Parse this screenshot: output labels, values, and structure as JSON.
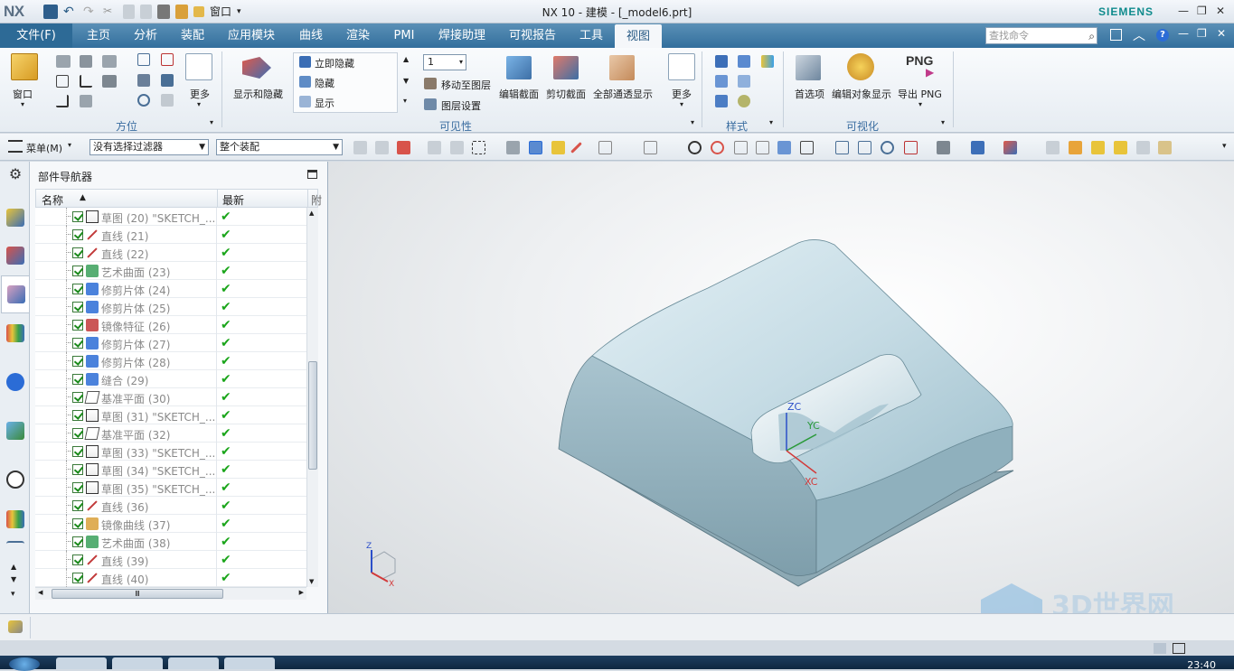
{
  "app": {
    "logo": "NX",
    "title": "NX 10 - 建模 - [_model6.prt]",
    "brand": "SIEMENS",
    "window_menu": "窗口",
    "controls": {
      "minimize": "—",
      "restore": "❐",
      "close": "✕"
    }
  },
  "tabs": [
    "主页",
    "分析",
    "装配",
    "应用模块",
    "曲线",
    "渲染",
    "PMI",
    "焊接助理",
    "可视报告",
    "工具",
    "视图"
  ],
  "file_tab": "文件(F)",
  "active_tab": "视图",
  "search": {
    "placeholder": "查找命令"
  },
  "ribbon": {
    "window_label": "窗口",
    "orientation_group": "方位",
    "more_label_1": "更多",
    "show_hide": "显示和隐藏",
    "immediate_hide": "立即隐藏",
    "hide": "隐藏",
    "show": "显示",
    "layer_value": "1",
    "move_to_layer": "移动至图层",
    "layer_settings": "图层设置",
    "visibility_group": "可见性",
    "edit_section": "编辑截面",
    "clip_section": "剪切截面",
    "all_transparent": "全部通透显示",
    "more_label_2": "更多",
    "style_group": "样式",
    "preferences": "首选项",
    "edit_object_display": "编辑对象显示",
    "export_png": "导出 PNG",
    "png_badge": "PNG",
    "visualization_group": "可视化"
  },
  "toolbar": {
    "menu": "菜单(M)",
    "filter": "没有选择过滤器",
    "scope": "整个装配"
  },
  "navigator": {
    "title": "部件导航器",
    "col_name": "名称",
    "col_latest": "最新",
    "col_extra": "附",
    "rows": [
      {
        "name": "草图 (20) \"SKETCH_...",
        "type": "sketch"
      },
      {
        "name": "直线 (21)",
        "type": "line"
      },
      {
        "name": "直线 (22)",
        "type": "line"
      },
      {
        "name": "艺术曲面 (23)",
        "type": "surface"
      },
      {
        "name": "修剪片体 (24)",
        "type": "trim"
      },
      {
        "name": "修剪片体 (25)",
        "type": "trim"
      },
      {
        "name": "镜像特征 (26)",
        "type": "mirror"
      },
      {
        "name": "修剪片体 (27)",
        "type": "trim"
      },
      {
        "name": "修剪片体 (28)",
        "type": "trim"
      },
      {
        "name": "缝合 (29)",
        "type": "sew"
      },
      {
        "name": "基准平面 (30)",
        "type": "plane"
      },
      {
        "name": "草图 (31) \"SKETCH_...",
        "type": "sketch"
      },
      {
        "name": "基准平面 (32)",
        "type": "plane"
      },
      {
        "name": "草图 (33) \"SKETCH_...",
        "type": "sketch"
      },
      {
        "name": "草图 (34) \"SKETCH_...",
        "type": "sketch"
      },
      {
        "name": "草图 (35) \"SKETCH_...",
        "type": "sketch"
      },
      {
        "name": "直线 (36)",
        "type": "line"
      },
      {
        "name": "镜像曲线 (37)",
        "type": "mirror-curve"
      },
      {
        "name": "艺术曲面 (38)",
        "type": "surface"
      },
      {
        "name": "直线 (39)",
        "type": "line"
      },
      {
        "name": "直线 (40)",
        "type": "line"
      }
    ],
    "scroll_mark": "Ⅲ"
  },
  "viewport": {
    "zc": "ZC",
    "yc": "YC",
    "xc": "XC",
    "triad_z": "Z",
    "triad_x": "X",
    "watermark": "3D世界网"
  },
  "taskbar": {
    "time": "23:40"
  },
  "colors": {
    "tab_bar": "#3f7aa6",
    "accent": "#3a6da0",
    "check": "#1aa51a",
    "model": "#b9d2dc"
  }
}
